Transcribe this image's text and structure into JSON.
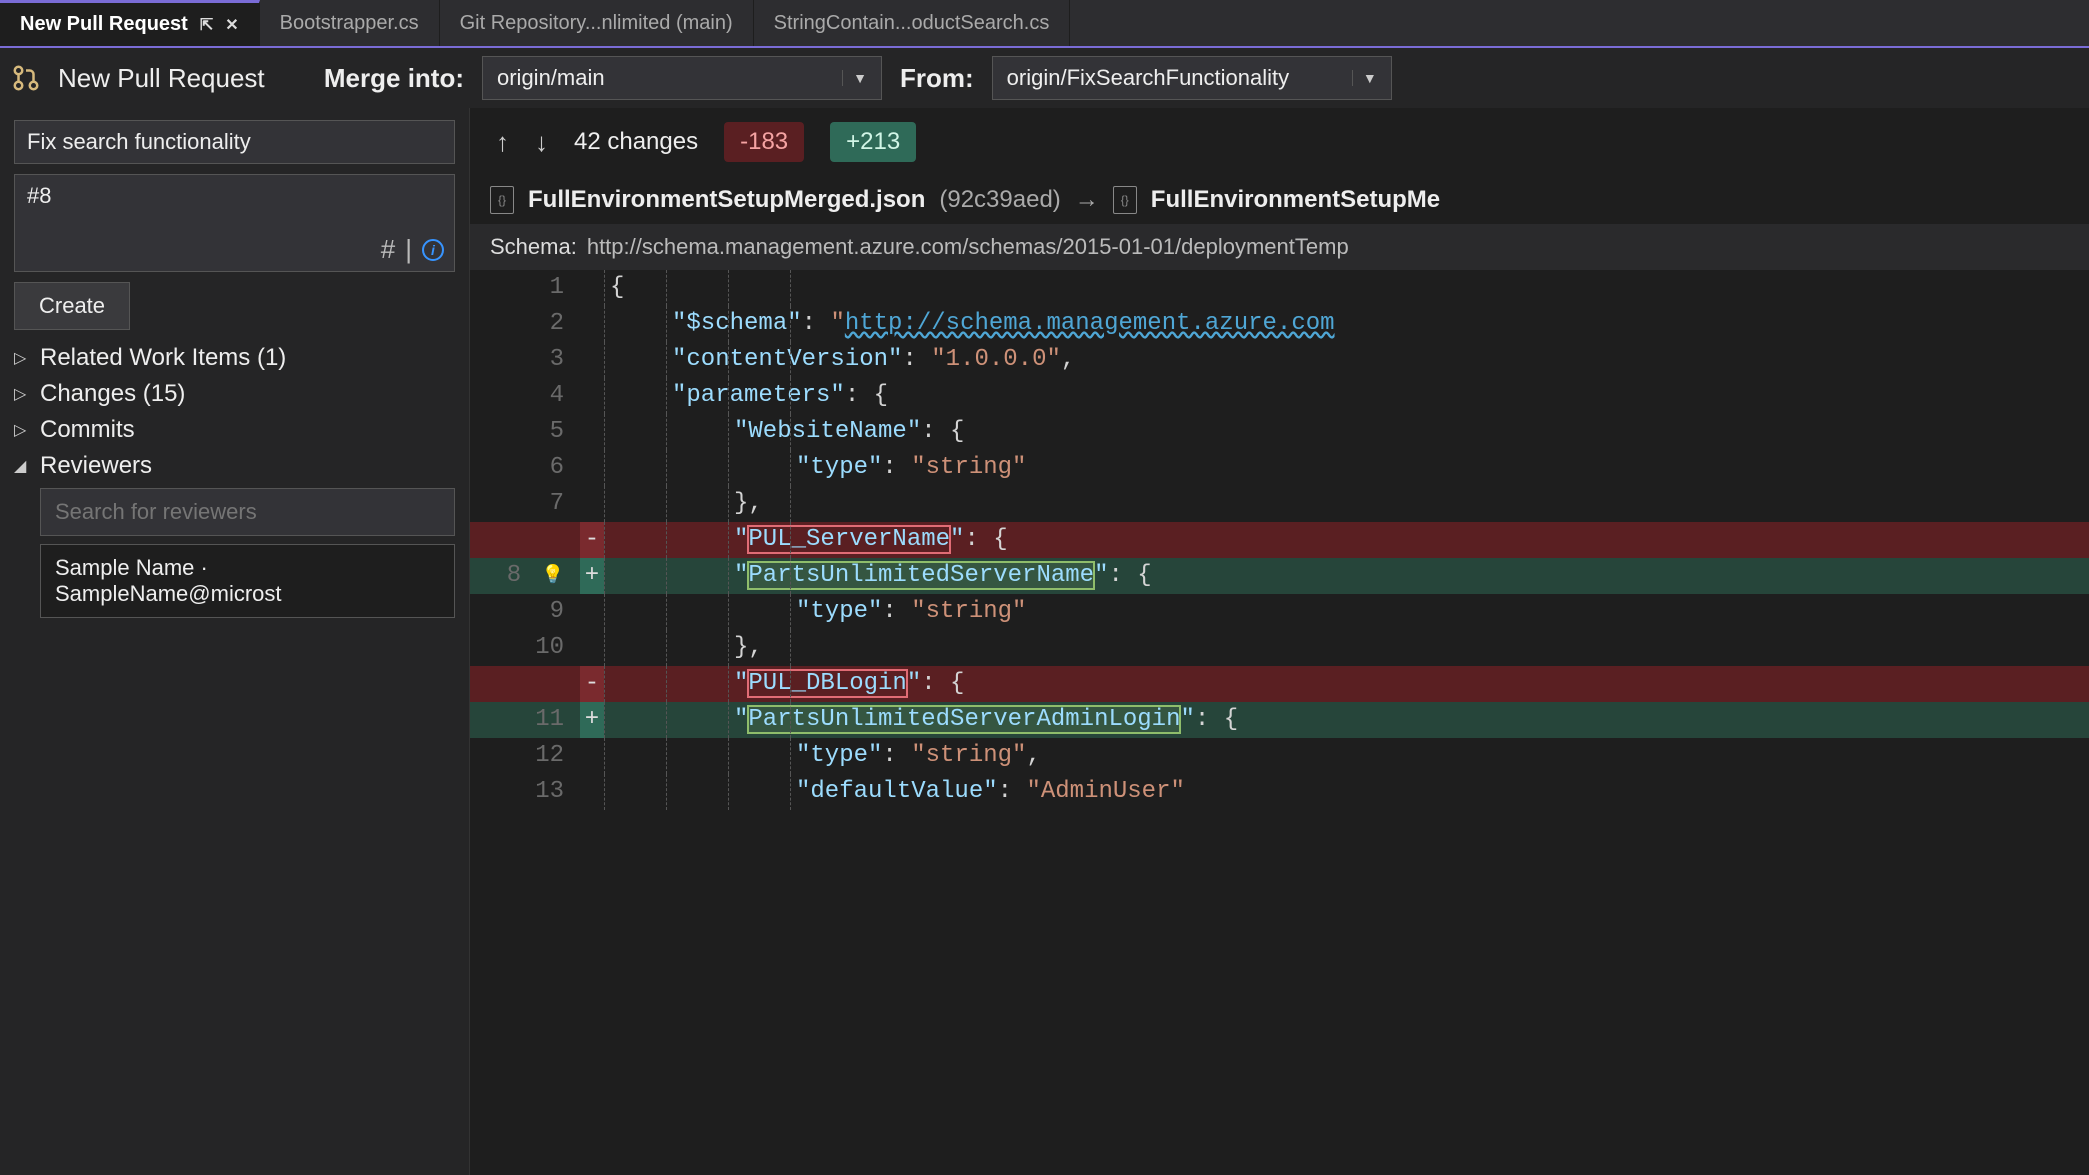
{
  "tabs": [
    {
      "label": "New Pull Request",
      "active": true
    },
    {
      "label": "Bootstrapper.cs"
    },
    {
      "label": "Git Repository...nlimited (main)"
    },
    {
      "label": "StringContain...oductSearch.cs"
    }
  ],
  "left": {
    "title": "New Pull Request",
    "merge_into_label": "Merge into:",
    "from_label": "From:",
    "merge_into_value": "origin/main",
    "from_value": "origin/FixSearchFunctionality",
    "pr_title_value": "Fix search functionality",
    "pr_desc_value": "#8",
    "create_label": "Create",
    "sections": {
      "related": "Related Work Items (1)",
      "changes": "Changes (15)",
      "commits": "Commits",
      "reviewers": "Reviewers"
    },
    "reviewer_search_placeholder": "Search for reviewers",
    "reviewer_item": "Sample Name · SampleName@microst"
  },
  "changes": {
    "count_label": "42 changes",
    "deletions": "-183",
    "additions": "+213"
  },
  "file": {
    "left_name": "FullEnvironmentSetupMerged.json",
    "left_rev": "(92c39aed)",
    "arrow": "→",
    "right_name": "FullEnvironmentSetupMe"
  },
  "schema": {
    "label": "Schema:",
    "value": "http://schema.management.azure.com/schemas/2015-01-01/deploymentTemp"
  },
  "code": {
    "lines": [
      {
        "n": "1",
        "pm": "",
        "kind": "",
        "indent": 0,
        "html": "<span class='tok-p'>{</span>"
      },
      {
        "n": "2",
        "pm": "",
        "kind": "",
        "indent": 1,
        "html": "<span class='tok-k'>\"$schema\"</span><span class='tok-p'>: </span><span class='tok-s'>\"</span><span class='tok-u'>http://schema.management.azure.com</span>"
      },
      {
        "n": "3",
        "pm": "",
        "kind": "",
        "indent": 1,
        "html": "<span class='tok-k'>\"contentVersion\"</span><span class='tok-p'>: </span><span class='tok-s'>\"1.0.0.0\"</span><span class='tok-p'>,</span>"
      },
      {
        "n": "4",
        "pm": "",
        "kind": "",
        "indent": 1,
        "html": "<span class='tok-k'>\"parameters\"</span><span class='tok-p'>: {</span>"
      },
      {
        "n": "5",
        "pm": "",
        "kind": "",
        "indent": 2,
        "html": "<span class='tok-k'>\"WebsiteName\"</span><span class='tok-p'>: {</span>"
      },
      {
        "n": "6",
        "pm": "",
        "kind": "",
        "indent": 3,
        "html": "<span class='tok-k'>\"type\"</span><span class='tok-p'>: </span><span class='tok-s'>\"string\"</span>"
      },
      {
        "n": "7",
        "pm": "",
        "kind": "",
        "indent": 2,
        "html": "<span class='tok-p'>},</span>"
      },
      {
        "n": "",
        "pm": "-",
        "kind": "deleted",
        "indent": 2,
        "html": "<span class='tok-k'>\"<span class='hl-old'>PUL_ServerName</span>\"</span><span class='tok-p'>: {</span>"
      },
      {
        "n": "8",
        "pm": "+",
        "kind": "added",
        "bulb": true,
        "indent": 2,
        "html": "<span class='tok-k'>\"<span class='hl-new'>PartsUnlimitedServerName</span>\"</span><span class='tok-p'>: {</span>"
      },
      {
        "n": "9",
        "pm": "",
        "kind": "",
        "indent": 3,
        "html": "<span class='tok-k'>\"type\"</span><span class='tok-p'>: </span><span class='tok-s'>\"string\"</span>"
      },
      {
        "n": "10",
        "pm": "",
        "kind": "",
        "indent": 2,
        "html": "<span class='tok-p'>},</span>"
      },
      {
        "n": "",
        "pm": "-",
        "kind": "deleted",
        "indent": 2,
        "html": "<span class='tok-k'>\"<span class='hl-old'>PUL_DBLogin</span>\"</span><span class='tok-p'>: {</span>"
      },
      {
        "n": "11",
        "pm": "+",
        "kind": "added",
        "indent": 2,
        "html": "<span class='tok-k'>\"<span class='hl-new'>PartsUnlimitedServerAdminLogin</span>\"</span><span class='tok-p'>: {</span>"
      },
      {
        "n": "12",
        "pm": "",
        "kind": "",
        "indent": 3,
        "html": "<span class='tok-k'>\"type\"</span><span class='tok-p'>: </span><span class='tok-s'>\"string\"</span><span class='tok-p'>,</span>"
      },
      {
        "n": "13",
        "pm": "",
        "kind": "",
        "indent": 3,
        "html": "<span class='tok-k'>\"defaultValue\"</span><span class='tok-p'>: </span><span class='tok-s'>\"AdminUser\"</span>"
      }
    ]
  }
}
